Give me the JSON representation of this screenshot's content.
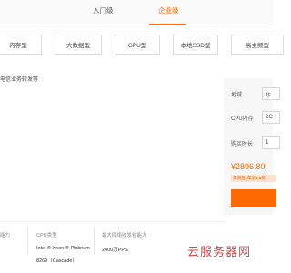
{
  "tabs": {
    "items": [
      "入门级",
      "企业级"
    ],
    "active": "企业级"
  },
  "categories": [
    "内存型",
    "大数据型",
    "GPU型",
    "本地SSD型",
    "高主频型"
  ],
  "description": "电信业务转发等",
  "config": {
    "region_label": "地域",
    "region_value": "华",
    "cpu_mem_label": "CPU内存",
    "cpu_mem_value": "2C",
    "duration_label": "购买时长",
    "duration_value": "1",
    "price": "¥2896.80",
    "price_note": "实例包1年享1.5折",
    "accent": "#ff6a00"
  },
  "specs": {
    "col0_header": "能力",
    "col1_header": "CPU类型",
    "col2_header": "最大网络收发包能力",
    "cpu_type_line1": "Intel ® Xeon ® Platinum",
    "cpu_type_line2": "8269（Cascade）",
    "pps": "2400万PPS"
  },
  "watermark": "云服务器网"
}
